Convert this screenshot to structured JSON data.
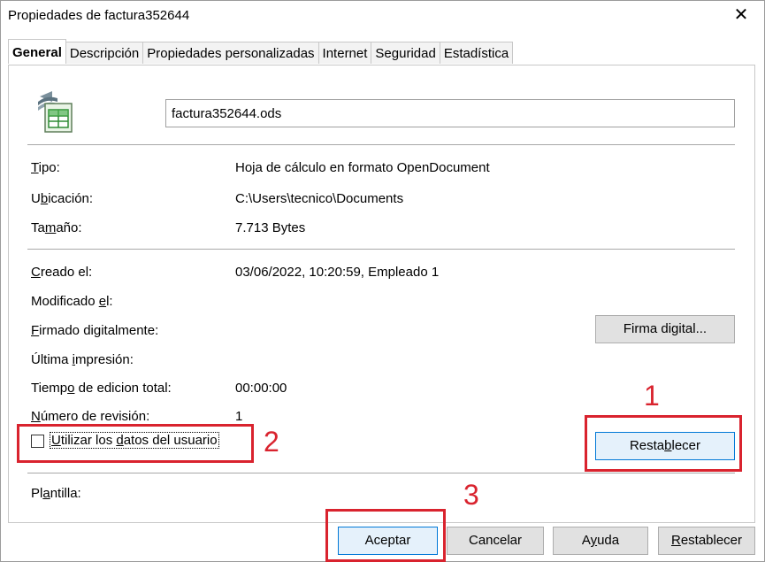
{
  "window": {
    "title": "Propiedades de  factura352644",
    "close_glyph": "✕"
  },
  "tabs": [
    {
      "label": "General",
      "active": true
    },
    {
      "label": "Descripción"
    },
    {
      "label": "Propiedades personalizadas"
    },
    {
      "label": "Internet"
    },
    {
      "label": "Seguridad"
    },
    {
      "label": "Estadística"
    }
  ],
  "file": {
    "name": "factura352644.ods",
    "icon": "spreadsheet-document-icon"
  },
  "info": {
    "type_label": "Tipo:",
    "type_value": "Hoja de cálculo en formato OpenDocument",
    "location_label": "Ubicación:",
    "location_value": "C:\\Users\\tecnico\\Documents",
    "size_label": "Tamaño:",
    "size_value": "7.713 Bytes"
  },
  "dates": {
    "created_label": "Creado el:",
    "created_value": "03/06/2022, 10:20:59, Empleado 1",
    "modified_label": "Modificado el:",
    "signed_label": "Firmado digitalmente:",
    "printed_label": "Última impresión:",
    "edit_time_label": "Tiempo de edicion total:",
    "edit_time_value": "00:00:00",
    "revision_label": "Número de revisión:",
    "revision_value": "1"
  },
  "buttons": {
    "digital_signature": "Firma digital...",
    "reset_inner": "Restablecer",
    "accept": "Aceptar",
    "cancel": "Cancelar",
    "help": "Ayuda",
    "reset_bottom": "Restablecer"
  },
  "checkbox": {
    "label": "Utilizar los datos del usuario",
    "checked": false
  },
  "template_label": "Plantilla:",
  "annotations": {
    "one": "1",
    "two": "2",
    "three": "3",
    "color": "#d9232e"
  }
}
